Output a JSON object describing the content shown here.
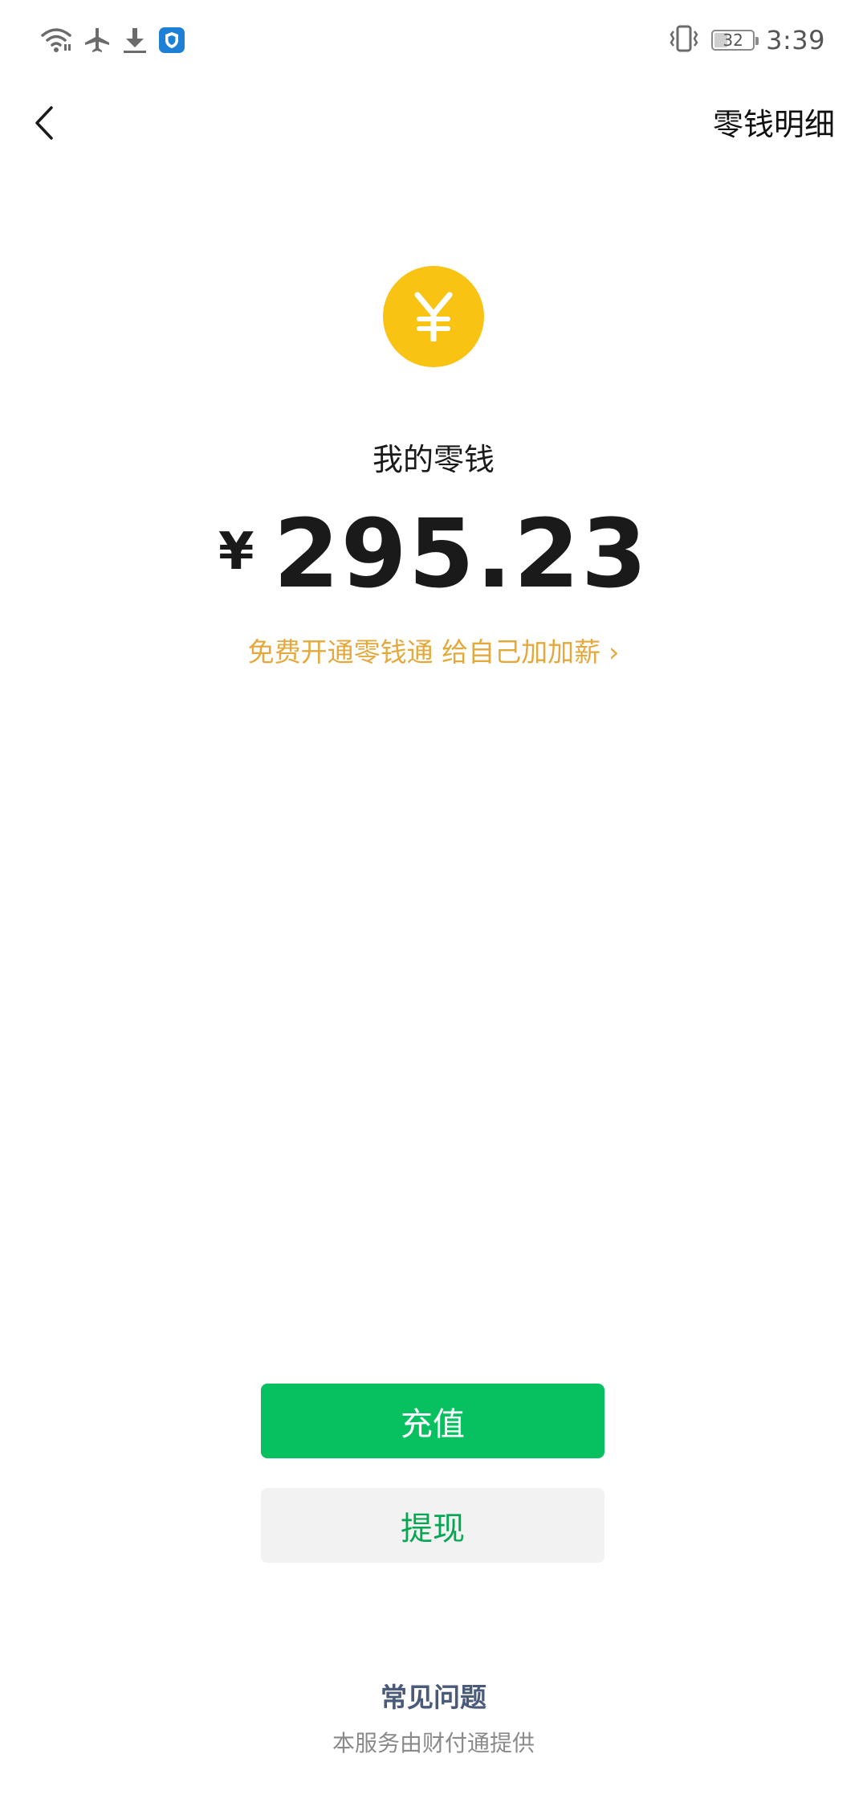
{
  "status_bar": {
    "icons_left": [
      "wifi-icon",
      "airplane-icon",
      "download-icon",
      "shield-app-icon"
    ],
    "icons_right": [
      "vibrate-icon",
      "battery-icon"
    ],
    "battery_level": "32",
    "time": "3:39"
  },
  "nav": {
    "back_icon": "chevron-left-icon",
    "right_link": "零钱明细"
  },
  "balance": {
    "coin_symbol": "¥",
    "title": "我的零钱",
    "currency": "¥",
    "amount": "295.23"
  },
  "promo": {
    "text": "免费开通零钱通 给自己加加薪",
    "arrow": "›"
  },
  "actions": {
    "recharge_label": "充值",
    "withdraw_label": "提现"
  },
  "footer": {
    "faq_label": "常见问题",
    "provider_note": "本服务由财付通提供"
  },
  "colors": {
    "primary_green": "#07c160",
    "coin_yellow": "#f9c314",
    "promo_orange": "#e3a93c",
    "faq_blue_gray": "#4a5a7a"
  }
}
